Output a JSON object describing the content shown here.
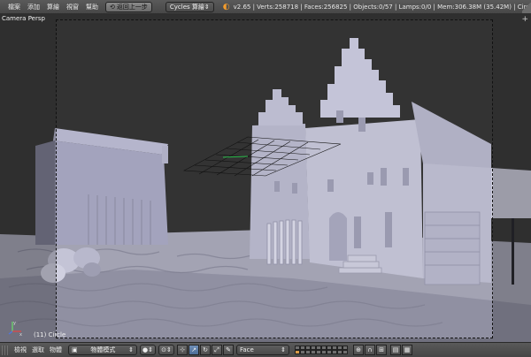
{
  "topbar": {
    "menus": [
      "檔案",
      "添加",
      "算繪",
      "視窗",
      "幫助"
    ],
    "back_button": "返回上一步",
    "engine": "Cycles 算繪",
    "stats": "v2.65 | Verts:258718 | Faces:256825 | Objects:0/57 | Lamps:0/0 | Mem:306.38M (35.42M) | Circle"
  },
  "viewport": {
    "camera_label": "Camera Persp",
    "object_label": "(11) Circle",
    "axes": {
      "x": "x",
      "y": "y"
    }
  },
  "bottombar": {
    "menus": [
      "檢視",
      "選取",
      "物體"
    ],
    "mode": "物體模式",
    "pivot_mode": "Face"
  },
  "colors": {
    "accent": "#d89a47",
    "selected": "#5a7aa5",
    "building": "#a8a8b8"
  },
  "icons": [
    "blender-icon",
    "undo-icon",
    "camera-icon",
    "shading-sphere-icon",
    "manipulator-icons",
    "snap-magnet-icon",
    "render-icon"
  ]
}
